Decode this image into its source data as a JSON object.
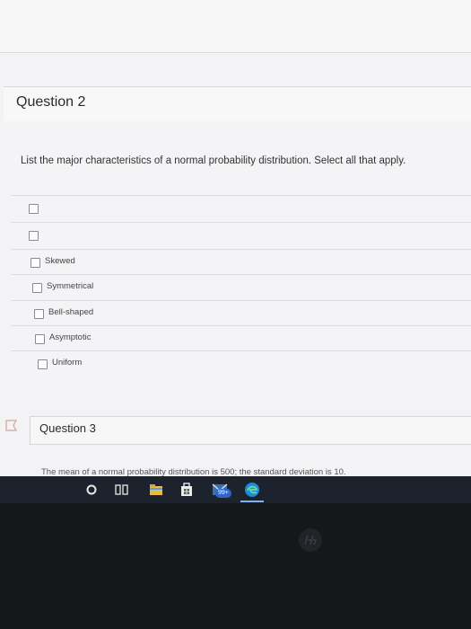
{
  "question2": {
    "title": "Question 2",
    "prompt": "List the major characteristics of a normal probability distribution. Select all that apply.",
    "options": [
      "",
      "",
      "Skewed",
      "Symmetrical",
      "Bell-shaped",
      "Asymptotic",
      "Uniform"
    ]
  },
  "question3": {
    "title": "Question 3",
    "text": "The mean of a normal probability distribution is 500; the standard deviation is 10."
  },
  "taskbar": {
    "badge_count": "99+"
  }
}
